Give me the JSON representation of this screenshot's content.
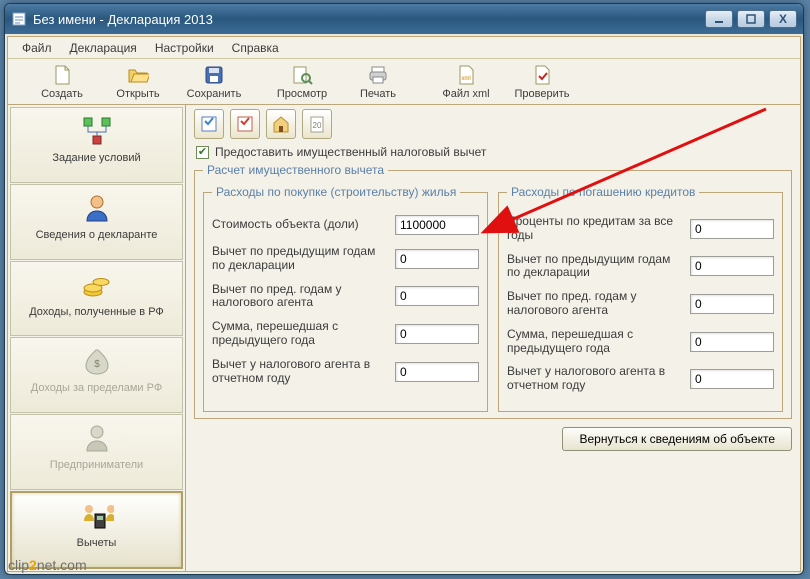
{
  "window": {
    "title": "Без имени - Декларация 2013"
  },
  "menu": {
    "file": "Файл",
    "declaration": "Декларация",
    "settings": "Настройки",
    "help": "Справка"
  },
  "toolbar": {
    "create": "Создать",
    "open": "Открыть",
    "save": "Сохранить",
    "preview": "Просмотр",
    "print": "Печать",
    "xml": "Файл xml",
    "check": "Проверить"
  },
  "sidebar": {
    "conditions": "Задание условий",
    "declarant": "Сведения о декларанте",
    "income_rf": "Доходы, полученные в РФ",
    "income_abroad": "Доходы за пределами РФ",
    "entrepreneurs": "Предприниматели",
    "deductions": "Вычеты"
  },
  "panel": {
    "provide_deduction": "Предоставить имущественный налоговый вычет",
    "calc_legend": "Расчет имущественного вычета",
    "left_legend": "Расходы по покупке (строительству) жилья",
    "right_legend": "Расходы по погашению кредитов",
    "left": {
      "object_cost_label": "Стоимость объекта (доли)",
      "object_cost_value": "1100000",
      "prev_years_decl_label": "Вычет по предыдущим годам по декларации",
      "prev_years_decl_value": "0",
      "prev_years_agent_label": "Вычет по пред. годам у налогового агента",
      "prev_years_agent_value": "0",
      "carryover_label": "Сумма, перешедшая с предыдущего года",
      "carryover_value": "0",
      "agent_current_label": "Вычет у налогового агента в отчетном году",
      "agent_current_value": "0"
    },
    "right": {
      "interest_all_label": "Проценты по кредитам за все годы",
      "interest_all_value": "0",
      "prev_years_decl_label": "Вычет по предыдущим годам по декларации",
      "prev_years_decl_value": "0",
      "prev_years_agent_label": "Вычет по пред. годам у налогового агента",
      "prev_years_agent_value": "0",
      "carryover_label": "Сумма, перешедшая с предыдущего года",
      "carryover_value": "0",
      "agent_current_label": "Вычет у налогового агента в отчетном году",
      "agent_current_value": "0"
    },
    "back_button": "Вернуться к сведениям об объекте"
  },
  "watermark": {
    "p1": "clip",
    "p2": "2",
    "p3": "net.com"
  }
}
